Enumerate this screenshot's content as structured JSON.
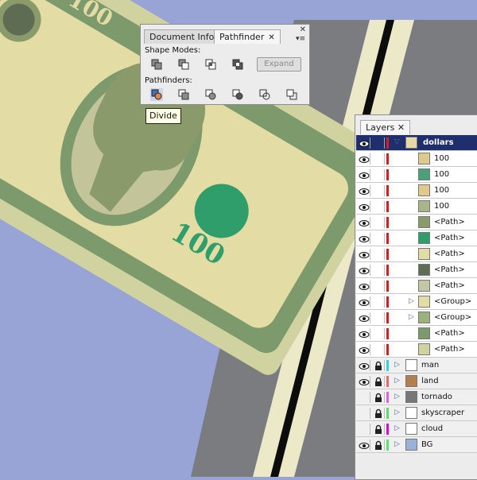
{
  "colors": {
    "background": "#98a3d6",
    "bill_paper": "#d0d39f",
    "bill_green": "#7d9a6c",
    "bill_face": "#e3dca4",
    "seal_green": "#2f9e6b",
    "road_gray": "#7b7c80",
    "road_light": "#ece9c9",
    "road_line": "#0c0c0c",
    "layer_header_bg": "#1f2f6e"
  },
  "canvas": {
    "denominations": [
      "100",
      "100",
      "100"
    ]
  },
  "pathfinder_panel": {
    "tabs": [
      "Document Info",
      "Pathfinder"
    ],
    "close_glyph": "✕",
    "window_close": "✕",
    "menu_glyph": "▾≡",
    "shape_modes_label": "Shape Modes:",
    "expand_label": "Expand",
    "pathfinders_label": "Pathfinders:",
    "tooltip": "Divide"
  },
  "layers_panel": {
    "tab_label": "Layers",
    "close_glyph": "✕",
    "layers": [
      {
        "name": "dollars",
        "header": true,
        "expanded": true,
        "locked": false,
        "color": "#e01a1a",
        "thumb": "#e7d9a6"
      },
      {
        "name": "100",
        "level": 1,
        "color": "#e01a1a",
        "thumb": "#e0c98c"
      },
      {
        "name": "100",
        "level": 1,
        "color": "#e01a1a",
        "thumb": "#4aa07a"
      },
      {
        "name": "100",
        "level": 1,
        "color": "#e01a1a",
        "thumb": "#e0c98c"
      },
      {
        "name": "100",
        "level": 1,
        "color": "#e01a1a",
        "thumb": "#a8b68a"
      },
      {
        "name": "<Path>",
        "level": 1,
        "color": "#e01a1a",
        "thumb": "#8a9a6a"
      },
      {
        "name": "<Path>",
        "level": 1,
        "color": "#e01a1a",
        "thumb": "#2f9e6b"
      },
      {
        "name": "<Path>",
        "level": 1,
        "color": "#e01a1a",
        "thumb": "#e3dca4"
      },
      {
        "name": "<Path>",
        "level": 1,
        "color": "#e01a1a",
        "thumb": "#5e6c53"
      },
      {
        "name": "<Path>",
        "level": 1,
        "color": "#e01a1a",
        "thumb": "#c4c7a4"
      },
      {
        "name": "<Group>",
        "level": 1,
        "group": true,
        "color": "#e01a1a",
        "thumb": "#e3dca4"
      },
      {
        "name": "<Group>",
        "level": 1,
        "group": true,
        "color": "#e01a1a",
        "thumb": "#9bb27d"
      },
      {
        "name": "<Path>",
        "level": 1,
        "color": "#e01a1a",
        "thumb": "#7d9a6c"
      },
      {
        "name": "<Path>",
        "level": 1,
        "color": "#e01a1a",
        "thumb": "#d0d39f"
      },
      {
        "name": "man",
        "header": false,
        "collapsed": true,
        "locked": true,
        "color": "#2ad6e6",
        "thumb": "#ffffff"
      },
      {
        "name": "land",
        "header": false,
        "collapsed": true,
        "locked": true,
        "color": "#e86a6a",
        "thumb": "#b57e4e"
      },
      {
        "name": "tornado",
        "header": false,
        "collapsed": true,
        "locked": true,
        "hidden": true,
        "color": "#e25ee6",
        "thumb": "#777777"
      },
      {
        "name": "skyscraper",
        "header": false,
        "collapsed": true,
        "locked": true,
        "hidden": true,
        "color": "#56e06b",
        "thumb": "#ffffff"
      },
      {
        "name": "cloud",
        "header": false,
        "collapsed": true,
        "locked": true,
        "hidden": true,
        "color": "#e000e0",
        "thumb": "#ffffff"
      },
      {
        "name": "BG",
        "header": false,
        "collapsed": true,
        "locked": true,
        "color": "#57e86b",
        "thumb": "#9bb0d6"
      }
    ],
    "eye_glyph": "👁",
    "lock_glyph": "🔒",
    "expand_glyph": "▷",
    "collapse_glyph": "▽"
  }
}
